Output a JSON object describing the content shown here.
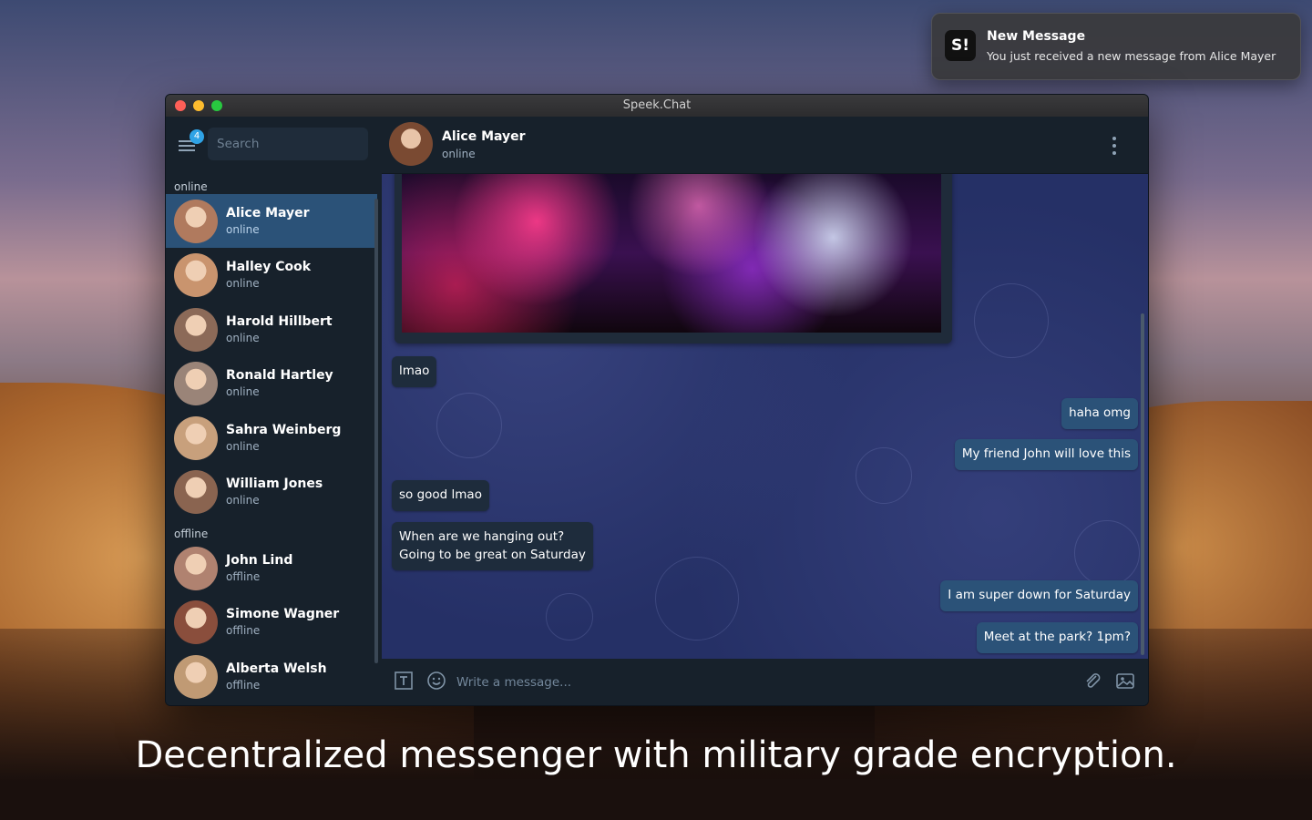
{
  "notification": {
    "app_icon_text": "S!",
    "title": "New Message",
    "text": "You just received a new message from Alice Mayer"
  },
  "window": {
    "title": "Speek.Chat"
  },
  "sidebar": {
    "menu_badge": "4",
    "search_placeholder": "Search",
    "online_label": "online",
    "offline_label": "offline",
    "online_contacts": [
      {
        "name": "Alice Mayer",
        "status": "online",
        "avatar_color": "#b07a5e"
      },
      {
        "name": "Halley Cook",
        "status": "online",
        "avatar_color": "#c9946e"
      },
      {
        "name": "Harold Hillbert",
        "status": "online",
        "avatar_color": "#8c6a58"
      },
      {
        "name": "Ronald Hartley",
        "status": "online",
        "avatar_color": "#9a8478"
      },
      {
        "name": "Sahra Weinberg",
        "status": "online",
        "avatar_color": "#c8a07c"
      },
      {
        "name": "William Jones",
        "status": "online",
        "avatar_color": "#8a6450"
      }
    ],
    "offline_contacts": [
      {
        "name": "John Lind",
        "status": "offline",
        "avatar_color": "#b08270"
      },
      {
        "name": "Simone Wagner",
        "status": "offline",
        "avatar_color": "#8a4e3c"
      },
      {
        "name": "Alberta Welsh",
        "status": "offline",
        "avatar_color": "#c09a74"
      }
    ]
  },
  "chat": {
    "contact_name": "Alice Mayer",
    "contact_status": "online",
    "messages": [
      {
        "dir": "in",
        "text": "lmao"
      },
      {
        "dir": "out",
        "text": "haha omg"
      },
      {
        "dir": "out",
        "text": "My friend John will love this"
      },
      {
        "dir": "in",
        "text": "so good lmao"
      },
      {
        "dir": "in",
        "text": "When are we hanging out?",
        "text2": "Going to be great on Saturday"
      },
      {
        "dir": "out",
        "text": "I am super down for Saturday"
      },
      {
        "dir": "out",
        "text": "Meet at the park? 1pm?"
      }
    ]
  },
  "composer": {
    "placeholder": "Write a message..."
  },
  "tagline": "Decentralized messenger with military grade encryption.",
  "colors": {
    "accent": "#2b5278",
    "badge": "#2fa3e6",
    "sidebar_bg": "#17212b",
    "chat_bg": "#253066"
  }
}
